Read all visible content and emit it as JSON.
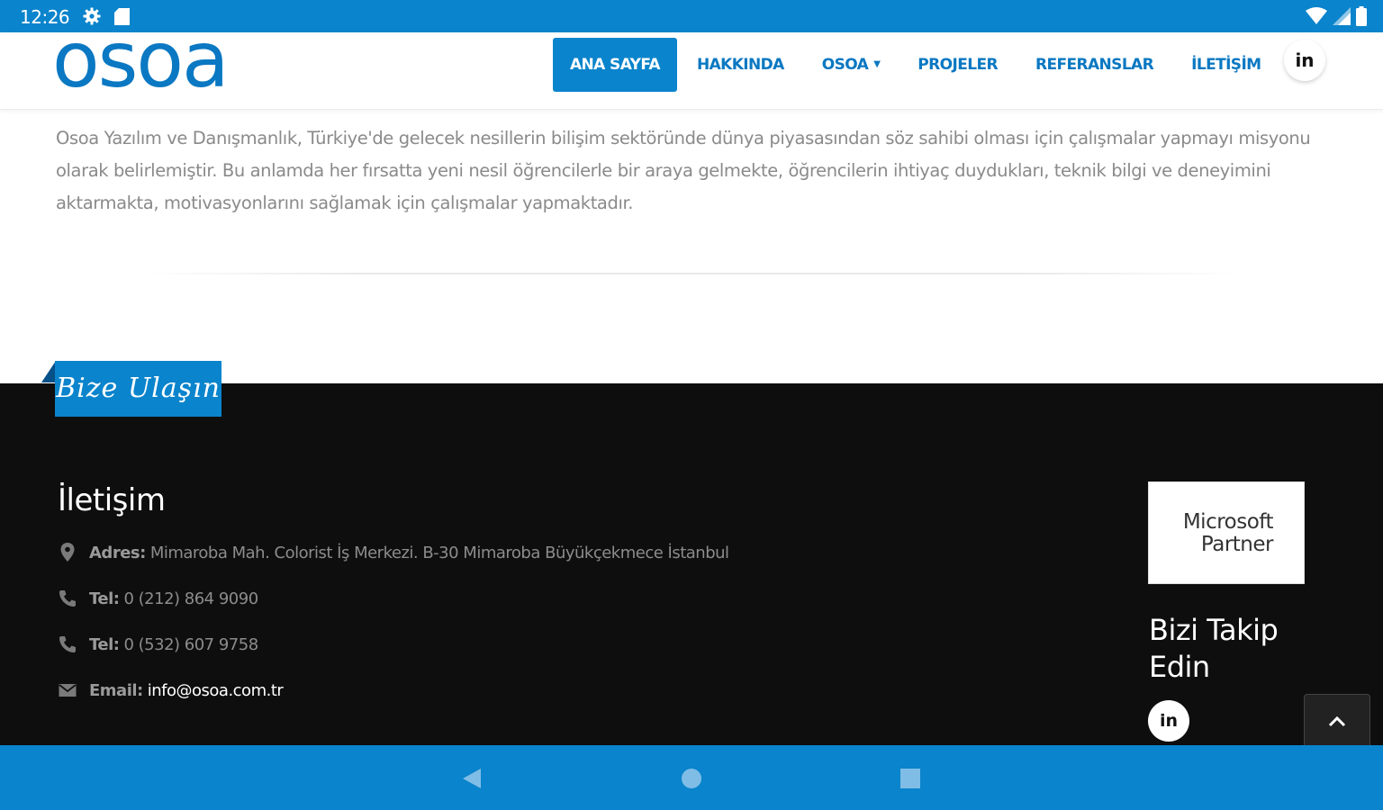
{
  "status_bar": {
    "time": "12:26",
    "icons": [
      "gear-icon",
      "sd-card-icon",
      "wifi-icon",
      "signal-icon",
      "battery-icon"
    ]
  },
  "header": {
    "logo": "osoa",
    "nav": [
      {
        "label": "ANA SAYFA",
        "active": true
      },
      {
        "label": "HAKKINDA",
        "active": false
      },
      {
        "label": "OSOA",
        "active": false,
        "dropdown": true
      },
      {
        "label": "PROJELER",
        "active": false
      },
      {
        "label": "REFERANSLAR",
        "active": false
      },
      {
        "label": "İLETİŞİM",
        "active": false
      }
    ],
    "social_label": "in"
  },
  "content": {
    "mission_text": "Osoa Yazılım ve Danışmanlık, Türkiye'de gelecek nesillerin bilişim sektöründe dünya piyasasından söz sahibi olması için çalışmalar yapmayı misyonu olarak belirlemiştir. Bu anlamda her fırsatta yeni nesil öğrencilerle bir araya gelmekte, öğrencilerin ihtiyaç duydukları, teknik bilgi ve deneyimini aktarmakta, motivasyonlarını sağlamak için çalışmalar yapmaktadır."
  },
  "footer": {
    "tab_label": "Bize Ulaşın",
    "contact_title": "İletişim",
    "address_label": "Adres:",
    "address_value": "Mimaroba Mah. Colorist İş Merkezi. B-30 Mimaroba Büyükçekmece İstanbul",
    "tel1_label": "Tel:",
    "tel1_value": "0 (212) 864 9090",
    "tel2_label": "Tel:",
    "tel2_value": "0 (532) 607 9758",
    "email_label": "Email:",
    "email_value": "info@osoa.com.tr",
    "badge_line1": "Microsoft",
    "badge_line2": "Partner",
    "follow_title": "Bizi Takip Edin",
    "social_label": "in"
  },
  "colors": {
    "brand_blue": "#0a84cc",
    "footer_bg": "#0e0e0e",
    "text_gray": "#8a8a8a"
  }
}
